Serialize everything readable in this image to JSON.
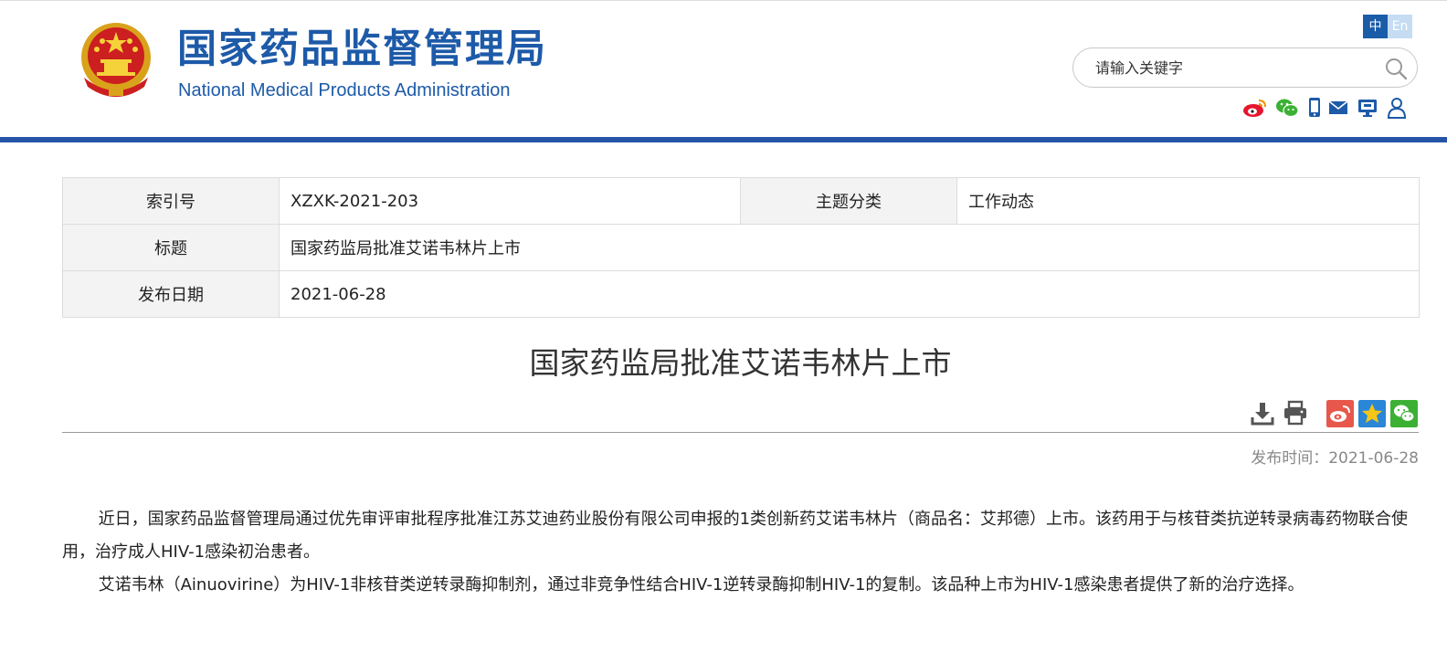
{
  "header": {
    "site_name_cn": "国家药品监督管理局",
    "site_name_en": "National Medical Products Administration",
    "lang_cn": "中",
    "lang_en": "En",
    "search_placeholder": "请输入关键字",
    "social_icons": [
      "weibo-icon",
      "wechat-icon",
      "mobile-icon",
      "mail-icon",
      "screen-icon",
      "user-icon"
    ]
  },
  "meta": {
    "index_label": "索引号",
    "index_value": "XZXK-2021-203",
    "category_label": "主题分类",
    "category_value": "工作动态",
    "title_label": "标题",
    "title_value": "国家药监局批准艾诺韦林片上市",
    "date_label": "发布日期",
    "date_value": "2021-06-28"
  },
  "article": {
    "title": "国家药监局批准艾诺韦林片上市",
    "publish_label": "发布时间：",
    "publish_date": "2021-06-28",
    "paragraphs": [
      "近日，国家药品监督管理局通过优先审评审批程序批准江苏艾迪药业股份有限公司申报的1类创新药艾诺韦林片（商品名：艾邦德）上市。该药用于与核苷类抗逆转录病毒药物联合使用，治疗成人HIV-1感染初治患者。",
      "艾诺韦林（Ainuovirine）为HIV-1非核苷类逆转录酶抑制剂，通过非竞争性结合HIV-1逆转录酶抑制HIV-1的复制。该品种上市为HIV-1感染患者提供了新的治疗选择。"
    ]
  },
  "colors": {
    "brand_blue": "#1d5aa8",
    "bar_blue": "#2655a8",
    "weibo_red": "#e8574b",
    "favorite_blue": "#2a86d6",
    "wechat_green": "#3cb034"
  }
}
